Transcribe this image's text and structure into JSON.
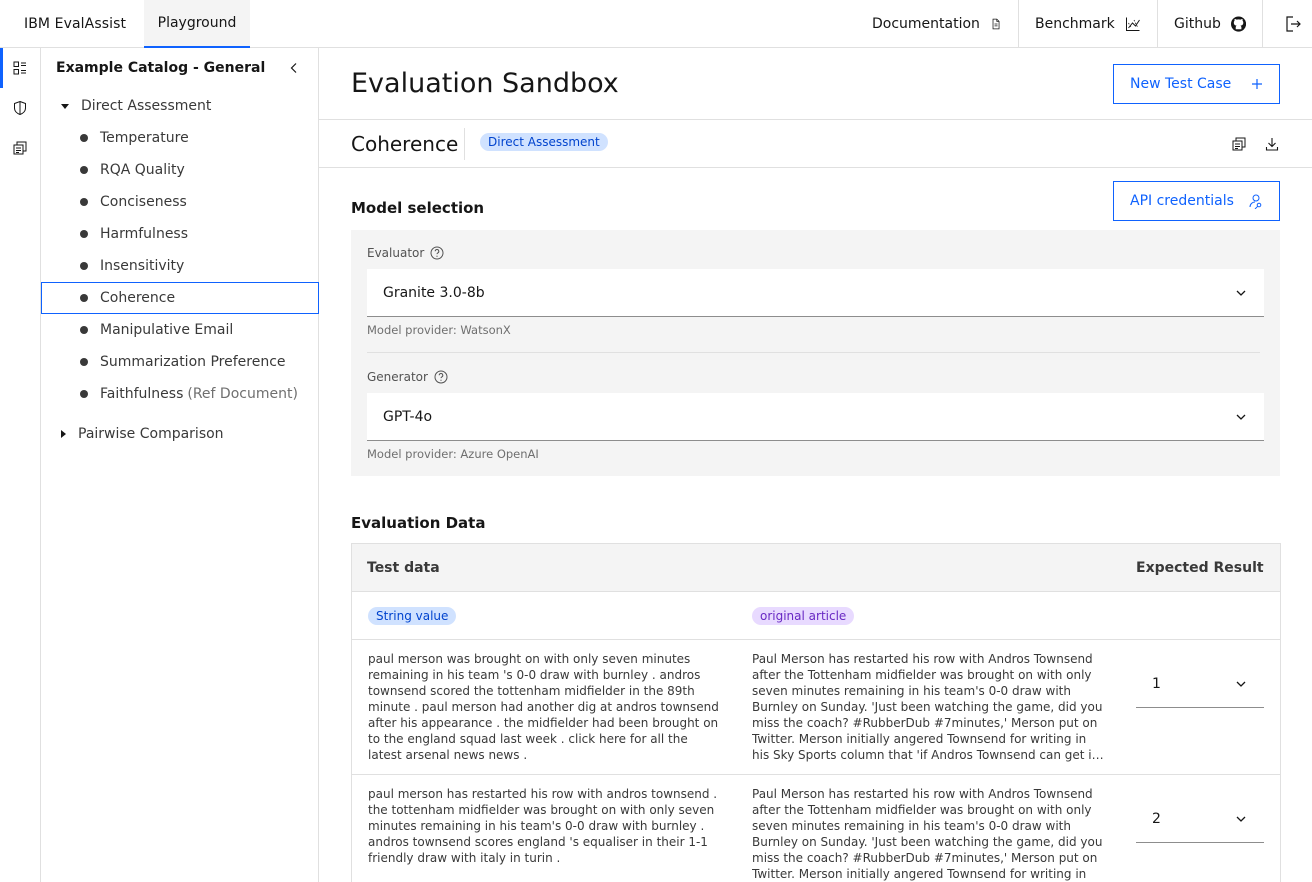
{
  "header": {
    "brand": "IBM EvalAssist",
    "tab_playground": "Playground",
    "nav": {
      "documentation": "Documentation",
      "benchmark": "Benchmark",
      "github": "Github"
    }
  },
  "catalog": {
    "title": "Example Catalog - General",
    "groups": [
      {
        "label": "Direct Assessment",
        "items": [
          {
            "label": "Temperature"
          },
          {
            "label": "RQA Quality"
          },
          {
            "label": "Conciseness"
          },
          {
            "label": "Harmfulness"
          },
          {
            "label": "Insensitivity"
          },
          {
            "label": "Coherence"
          },
          {
            "label": "Manipulative Email"
          },
          {
            "label": "Summarization Preference"
          },
          {
            "label": "Faithfulness",
            "suffix": "(Ref Document)"
          }
        ]
      },
      {
        "label": "Pairwise Comparison"
      }
    ]
  },
  "main": {
    "title": "Evaluation Sandbox",
    "new_test_case": "New Test Case",
    "criteria_name": "Coherence",
    "criteria_tag": "Direct Assessment",
    "model_section": {
      "title": "Model selection",
      "api_credentials": "API credentials",
      "evaluator": {
        "label": "Evaluator",
        "value": "Granite 3.0-8b",
        "helper": "Model provider: WatsonX"
      },
      "generator": {
        "label": "Generator",
        "value": "GPT-4o",
        "helper": "Model provider: Azure OpenAI"
      }
    },
    "data_section": {
      "title": "Evaluation Data",
      "columns": {
        "test_data": "Test data",
        "expected": "Expected Result"
      },
      "tags": {
        "string_value": "String value",
        "original_article": "original article"
      },
      "rows": [
        {
          "response": "paul merson was brought on with only seven minutes remaining in his team 's 0-0 draw with burnley . andros townsend scored the tottenham midfielder in the 89th minute . paul merson had another dig at andros townsend after his appearance . the midfielder had been brought on to the england squad last week . click here for all the latest arsenal news news .",
          "article": "Paul Merson has restarted his row with Andros Townsend after the Tottenham midfielder was brought on with only seven minutes remaining in his team's 0-0 draw with Burnley on Sunday. 'Just been watching the game, did you miss the coach? #RubberDub #7minutes,' Merson put on Twitter. Merson initially angered Townsend for writing in his Sky Sports column that 'if Andros Townsend can get in (the England team)",
          "expected": "1"
        },
        {
          "response": "paul merson has restarted his row with andros townsend . the tottenham midfielder was brought on with only seven minutes remaining in his team's 0-0 draw with burnley . andros townsend scores england 's equaliser in their 1-1 friendly draw with italy in turin .",
          "article": "Paul Merson has restarted his row with Andros Townsend after the Tottenham midfielder was brought on with only seven minutes remaining in his team's 0-0 draw with Burnley on Sunday. 'Just been watching the game, did you miss the coach? #RubberDub #7minutes,' Merson put on Twitter. Merson initially angered Townsend for writing in his Sky",
          "expected": "2"
        }
      ]
    }
  }
}
